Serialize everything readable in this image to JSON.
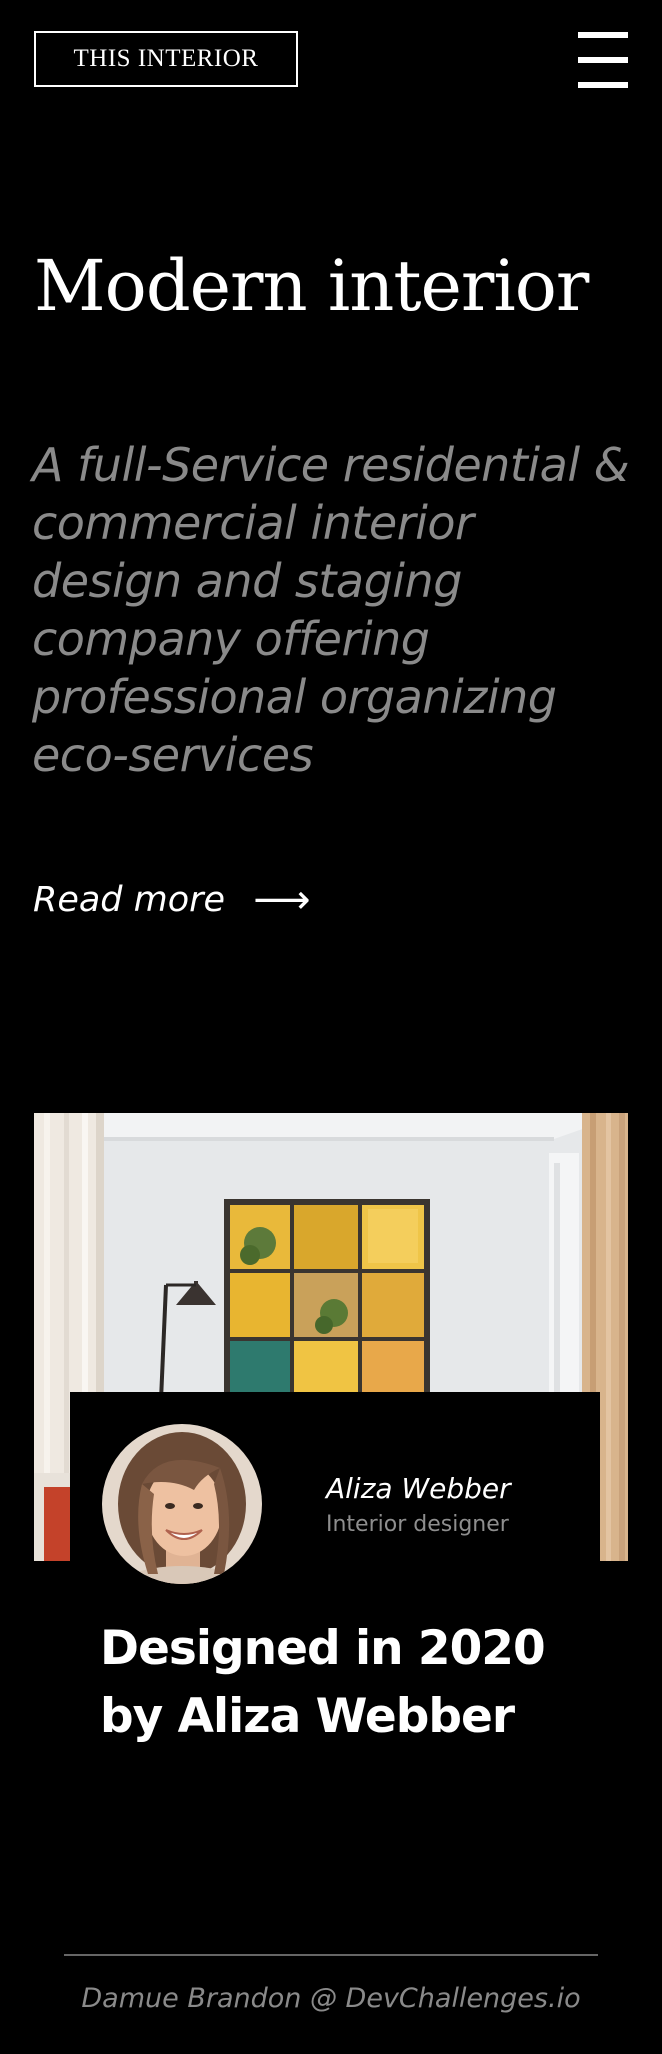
{
  "header": {
    "brand": "THIS INTERIOR",
    "menu_icon": "hamburger-menu-icon"
  },
  "hero": {
    "title": "Modern interior",
    "description": "A full-Service residential & commercial interior design and staging company offering professional organizing eco-services",
    "read_more_label": "Read more",
    "read_more_icon": "arrow-right-icon"
  },
  "project": {
    "photo": "living-room-photo",
    "designer_name": "Aliza Webber",
    "designer_role": "Interior designer",
    "headline": "Designed in 2020 by Aliza Webber"
  },
  "footer": {
    "credit": "Damue Brandon @ DevChallenges.io"
  },
  "colors": {
    "background": "#000000",
    "text": "#ffffff",
    "muted": "#8a8a8a",
    "accent_yellow": "#e8b82c"
  }
}
